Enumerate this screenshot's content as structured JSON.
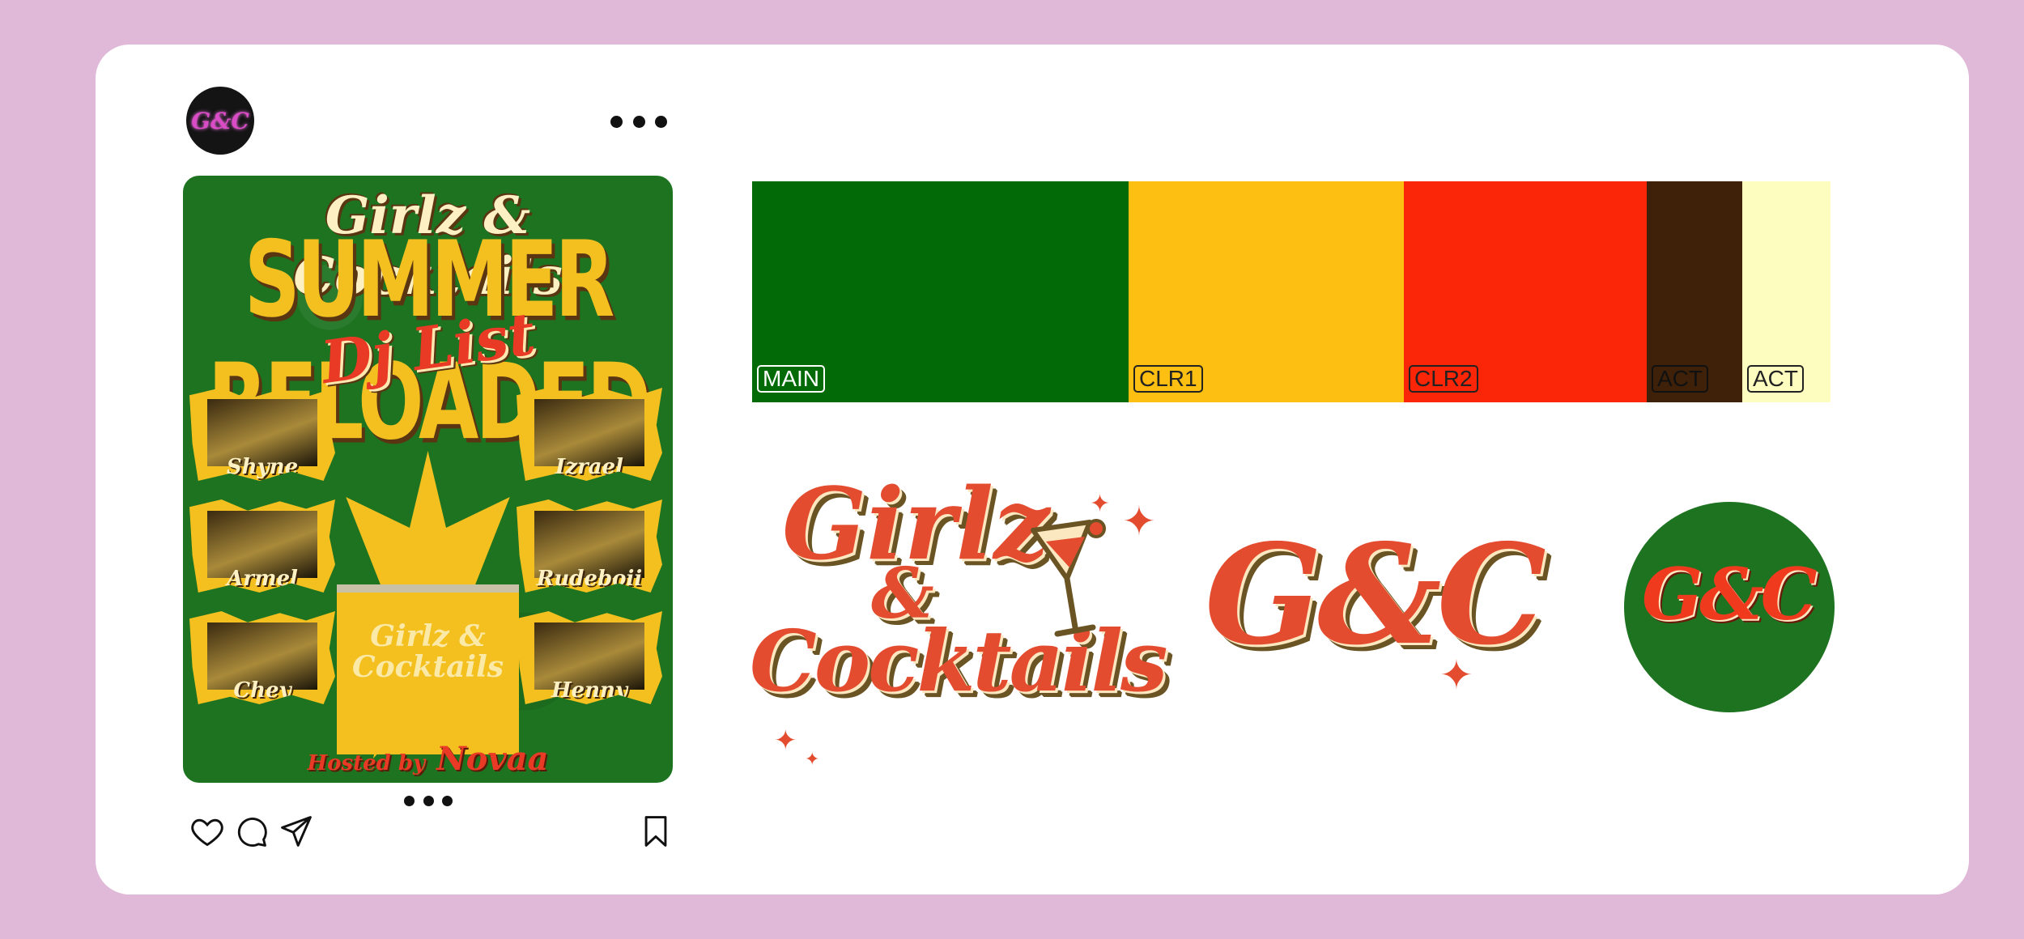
{
  "post": {
    "avatar_text": "G&C",
    "poster": {
      "title_line1": "Girlz & Cocktails",
      "title_line2": "SUMMER RELOADED",
      "title_line3": "Dj List",
      "djs": [
        "Shyne",
        "Izrael",
        "Armel",
        "Rudeboii",
        "Chey",
        "Henny"
      ],
      "center_logo": "Girlz & Cocktails",
      "hosted_by": "Hosted by",
      "host": "Novaa"
    },
    "actions": [
      "heart-icon",
      "comment-icon",
      "share-icon",
      "bookmark-icon"
    ]
  },
  "palette": [
    {
      "label": "MAIN",
      "color": "#026a06",
      "label_color": "#ffffff"
    },
    {
      "label": "CLR1",
      "color": "#fcbf12",
      "label_color": "#222222"
    },
    {
      "label": "CLR2",
      "color": "#fb2607",
      "label_color": "#222222"
    },
    {
      "label": "ACT",
      "color": "#3e2108",
      "label_color": "#111111"
    },
    {
      "label": "ACT",
      "color": "#fefdc0",
      "label_color": "#222222"
    }
  ],
  "logos": {
    "primary_line1": "Girlz",
    "primary_amp": "&",
    "primary_line2": "Cocktails",
    "monogram": "G&C",
    "badge_monogram": "G&C"
  },
  "colors": {
    "background": "#e0b9d8",
    "card": "#ffffff",
    "logo_red": "#e44c30",
    "logo_outline": "#6b5424"
  }
}
